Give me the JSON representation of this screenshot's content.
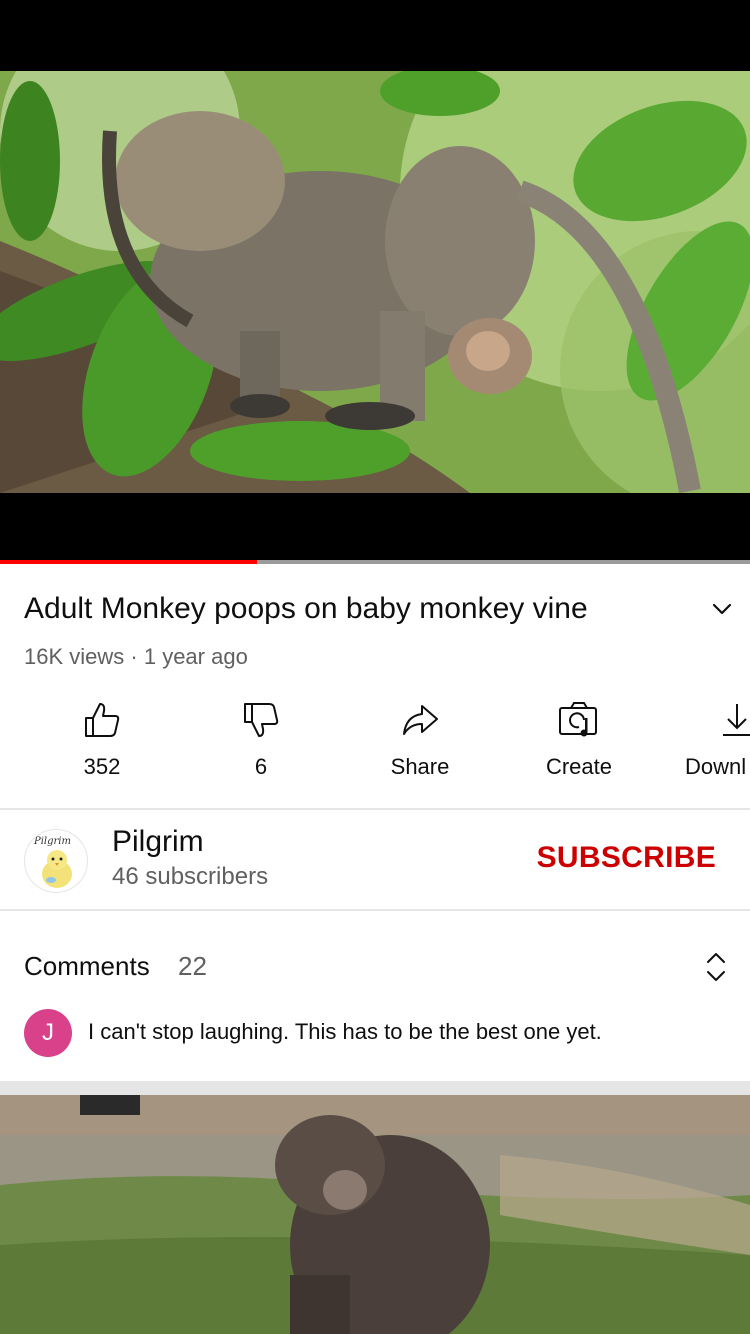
{
  "video": {
    "title": "Adult Monkey poops on baby monkey vine",
    "views": "16K views",
    "age": "1 year ago",
    "meta_separator": " · ",
    "progress_fraction": 0.343
  },
  "actions": [
    {
      "label": "352",
      "icon": "thumbs-up-icon"
    },
    {
      "label": "6",
      "icon": "thumbs-down-icon"
    },
    {
      "label": "Share",
      "icon": "share-icon"
    },
    {
      "label": "Create",
      "icon": "create-icon"
    },
    {
      "label": "Downl",
      "icon": "download-icon"
    }
  ],
  "channel": {
    "name": "Pilgrim",
    "subscribers": "46 subscribers",
    "avatar_text": "Pilgrim",
    "subscribe_label": "SUBSCRIBE"
  },
  "comments": {
    "title": "Comments",
    "count": "22",
    "first_comment": {
      "avatar_letter": "J",
      "text": "I can't stop laughing. This has to be the best one yet."
    }
  },
  "colors": {
    "accent": "#ff0000",
    "subscribe": "#cc0000",
    "comment_avatar": "#d9418a"
  }
}
